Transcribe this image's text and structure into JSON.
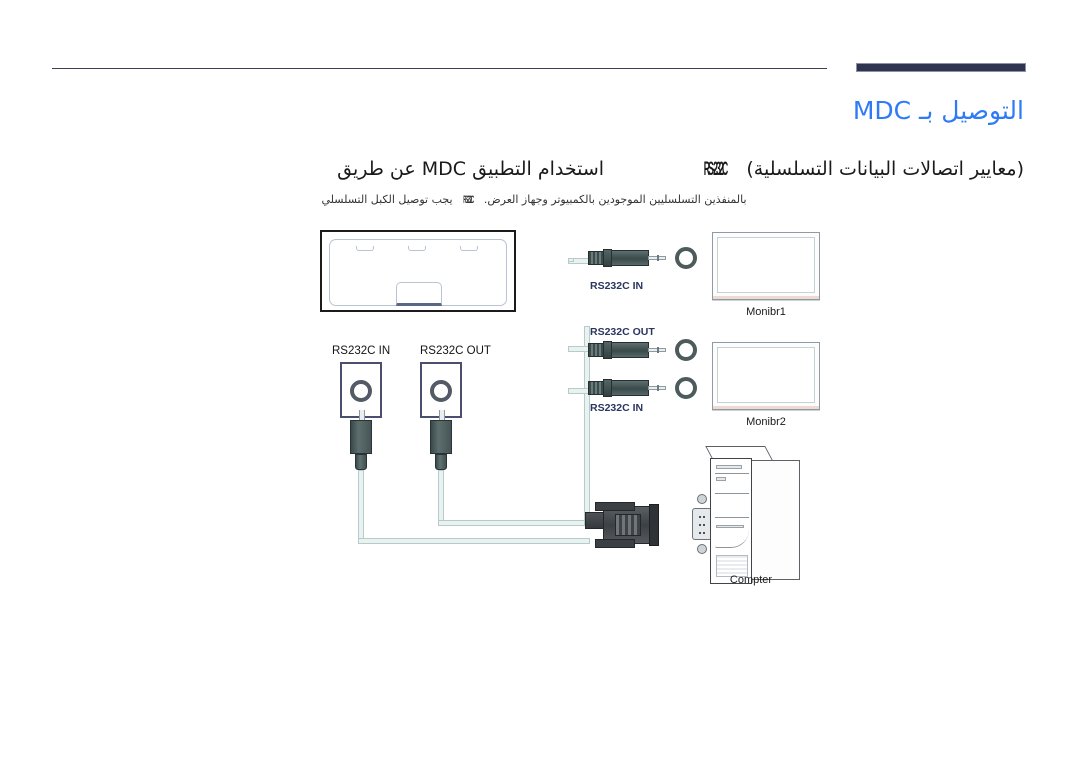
{
  "document": {
    "language": "ar",
    "direction": "rtl",
    "accent_color": "#2f7bf6",
    "header_bar_color": "#2e3350",
    "rule_color": "#3b3f57"
  },
  "header": {
    "title": "التوصيل بـ MDC"
  },
  "section": {
    "subtitle_before": "استخدام التطبيق MDC عن طريق",
    "subtitle_standard": "RS-232C",
    "subtitle_after": "(معايير اتصالات البيانات التسلسلية)",
    "note_before": "يجب توصيل الكبل التسلسلي",
    "note_standard": "RS-232C",
    "note_after": "بالمنفذين التسلسليين الموجودين بالكمبيوتر وجهاز العرض."
  },
  "diagram": {
    "name": "mdc-rs232c-connection-diagram",
    "display_panel": {
      "label": "display-rear-panel",
      "port_in_label": "RS232C IN",
      "port_out_label": "RS232C OUT"
    },
    "cable_labels": {
      "monitor1_in": "RS232C IN",
      "monitor2_out": "RS232C OUT",
      "monitor2_in": "RS232C IN"
    },
    "monitors": [
      {
        "label": "Monibr1"
      },
      {
        "label": "Monibr2"
      }
    ],
    "computer": {
      "label": "Compter"
    },
    "connector": {
      "type": "d-sub-9-pin-serial"
    }
  }
}
